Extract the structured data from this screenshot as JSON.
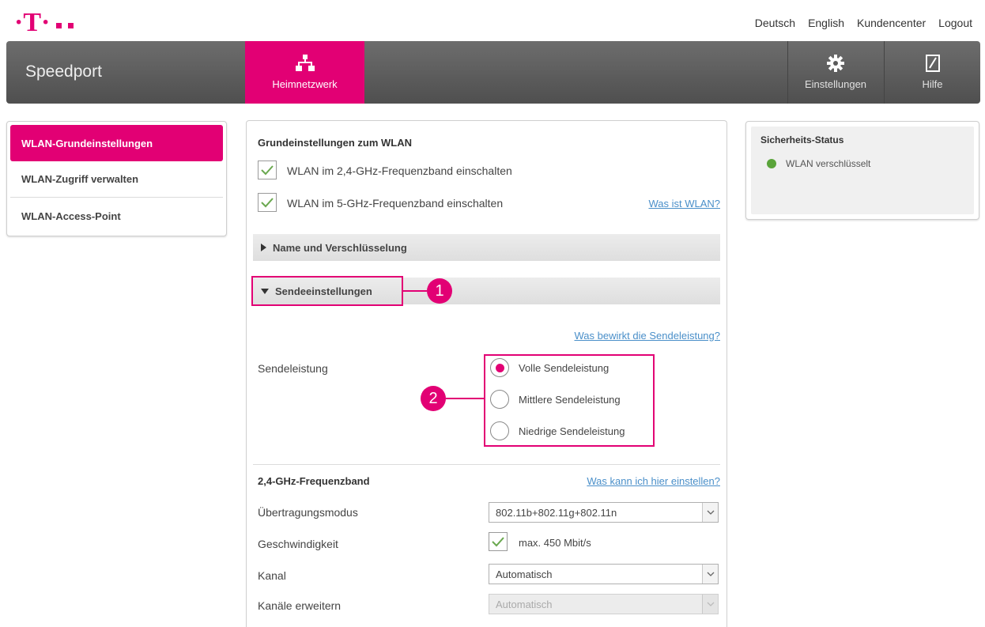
{
  "header": {
    "links": [
      "Deutsch",
      "English",
      "Kundencenter",
      "Logout"
    ]
  },
  "nav": {
    "brand": "Speedport",
    "tabs": [
      {
        "label": "Heimnetzwerk",
        "icon": "network-icon",
        "active": true
      },
      {
        "label": "Einstellungen",
        "icon": "gear-icon",
        "active": false
      },
      {
        "label": "Hilfe",
        "icon": "help-book-icon",
        "active": false
      }
    ]
  },
  "sidebar": {
    "items": [
      {
        "label": "WLAN-Grundeinstellungen",
        "active": true
      },
      {
        "label": "WLAN-Zugriff verwalten",
        "active": false
      },
      {
        "label": "WLAN-Access-Point",
        "active": false
      }
    ]
  },
  "main": {
    "title": "Grundeinstellungen zum WLAN",
    "checkbox_24": {
      "label": "WLAN im 2,4-GHz-Frequenzband einschalten",
      "checked": true
    },
    "checkbox_5": {
      "label": "WLAN im 5-GHz-Frequenzband einschalten",
      "checked": true
    },
    "link_wlan": "Was ist WLAN?",
    "accordion_name": "Name und Verschlüsselung",
    "accordion_send": "Sendeeinstellungen",
    "marker_1": "1",
    "marker_2": "2",
    "link_sendeleistung": "Was bewirkt die Sendeleistung?",
    "sendeleistung_label": "Sendeleistung",
    "radio_options": [
      {
        "label": "Volle Sendeleistung",
        "selected": true
      },
      {
        "label": "Mittlere Sendeleistung",
        "selected": false
      },
      {
        "label": "Niedrige Sendeleistung",
        "selected": false
      }
    ],
    "band_title": "2,4-GHz-Frequenzband",
    "link_einstellen": "Was kann ich hier einstellen?",
    "mode_label": "Übertragungsmodus",
    "mode_value": "802.11b+802.11g+802.11n",
    "speed_label": "Geschwindigkeit",
    "speed_value": "max. 450 Mbit/s",
    "speed_checked": true,
    "channel_label": "Kanal",
    "channel_value": "Automatisch",
    "extend_label": "Kanäle erweitern",
    "extend_value": "Automatisch"
  },
  "status_panel": {
    "title": "Sicherheits-Status",
    "item": "WLAN verschlüsselt"
  },
  "colors": {
    "accent": "#e20074",
    "nav_bg": "#5e5e5e",
    "link": "#4a8fc9",
    "status_ok": "#5aa43a"
  }
}
